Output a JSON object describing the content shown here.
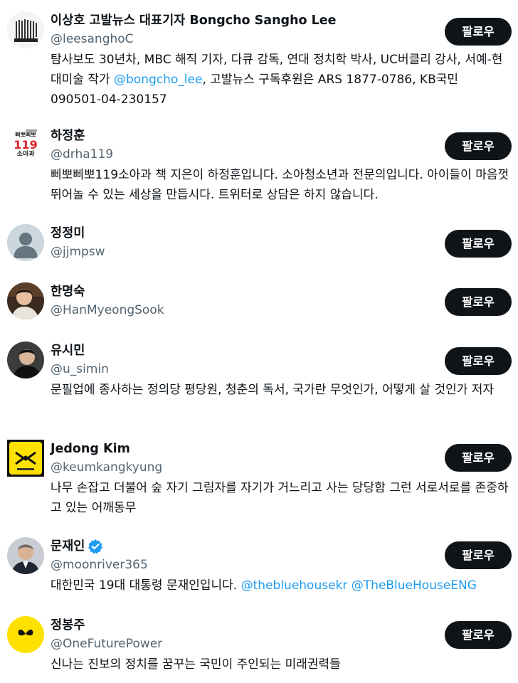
{
  "follow_label": "팔로우",
  "users": [
    {
      "name": "이상호 고발뉴스 대표기자 Bongcho Sangho Lee",
      "handle": "@leesanghoC",
      "bio_parts": [
        "탐사보도 30년차, MBC 해직 기자, 다큐 감독, 연대 정치학 박사, UC버클리 강사, 서예-현대미술 작가 ",
        "@bongcho_lee",
        ", 고발뉴스 구독후원은 ARS 1877-0786, KB국민 090501-04-230157"
      ]
    },
    {
      "name": "하정훈",
      "handle": "@drha119",
      "bio": "삐뽀삐뽀119소아과 책 지은이 하정훈입니다. 소아청소년과 전문의입니다. 아이들이 마음껏 뛰어놀 수 있는 세상을 만듭시다. 트위터로 상담은 하지 않습니다.",
      "avatar_text": [
        "삐뽀삐뽀",
        "119",
        "소아과"
      ]
    },
    {
      "name": "정정미",
      "handle": "@jjmpsw"
    },
    {
      "name": "한명숙",
      "handle": "@HanMyeongSook"
    },
    {
      "name": "유시민",
      "handle": "@u_simin",
      "bio": "문필업에 종사하는 정의당 평당원, 청춘의 독서, 국가란 무엇인가, 어떻게 살 것인가 저자"
    },
    {
      "name": "Jedong Kim",
      "handle": "@keumkangkyung",
      "bio": "나무 손잡고 더불어 숲 자기 그림자를 자기가 거느리고 사는 당당함 그런 서로서로를 존중하고 있는 어깨동무"
    },
    {
      "name": "문재인",
      "handle": "@moonriver365",
      "verified": true,
      "bio_parts": [
        "대한민국 19대 대통령 문재인입니다. ",
        "@thebluehousekr",
        " ",
        "@TheBlueHouseENG"
      ]
    },
    {
      "name": "정봉주",
      "handle": "@OneFuturePower",
      "bio": "신나는 진보의 정치를 꿈꾸는 국민이 주인되는 미래권력들"
    }
  ],
  "colors": {
    "text": "#0f1419",
    "secondary": "#536471",
    "link": "#1d9bf0",
    "button_bg": "#0f1419",
    "button_text": "#ffffff",
    "yellow": "#ffe100"
  }
}
